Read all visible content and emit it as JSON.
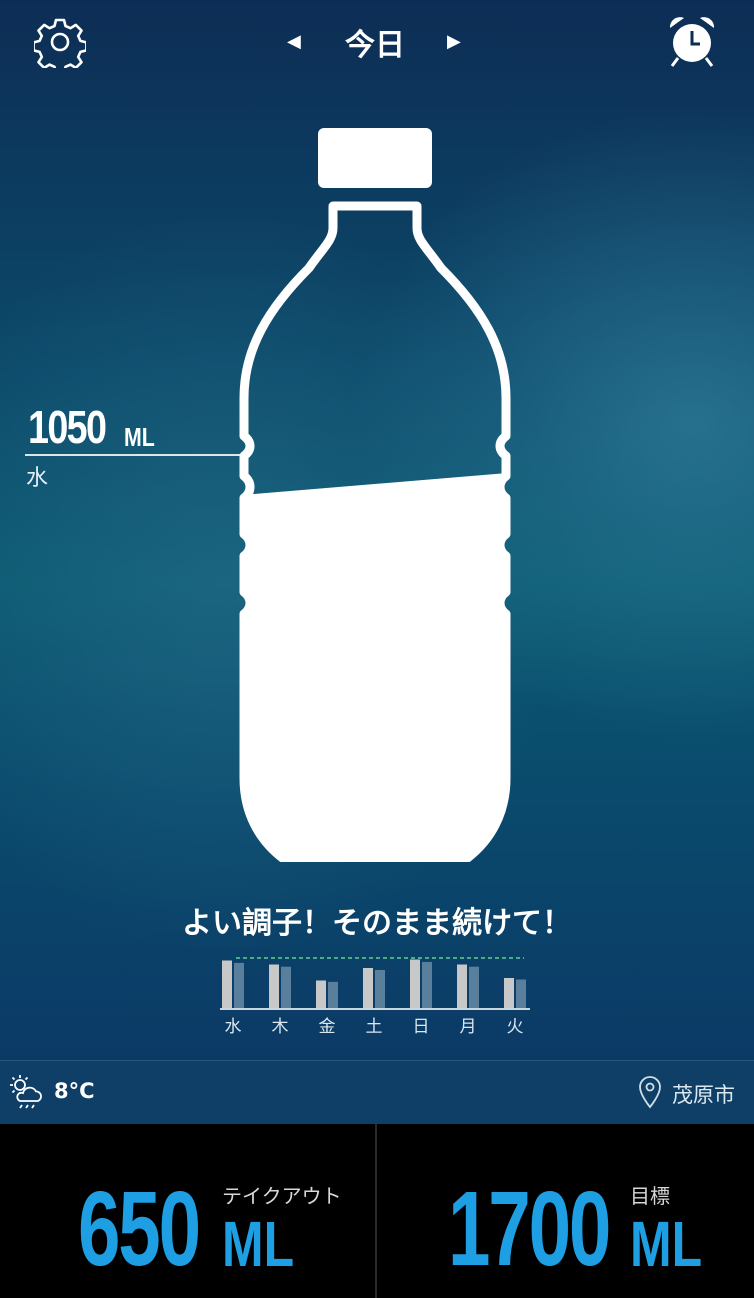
{
  "header": {
    "title": "今日",
    "prev_icon": "◀",
    "next_icon": "▶",
    "settings_icon": "gear-icon",
    "alarm_icon": "alarm-clock-icon"
  },
  "intake": {
    "value": "1050",
    "unit": "ML",
    "drink": "水",
    "fill_fraction": 0.6
  },
  "message": "よい調子！そのまま続けて！",
  "weekly": {
    "days": [
      "水",
      "木",
      "金",
      "土",
      "日",
      "月",
      "火"
    ],
    "values": [
      0.95,
      0.87,
      0.55,
      0.8,
      0.97,
      0.87,
      0.6
    ],
    "targets": [
      0.95,
      0.87,
      0.55,
      0.8,
      0.97,
      0.87,
      0.6
    ]
  },
  "weather": {
    "temperature": "8°C",
    "location": "茂原市",
    "weather_icon": "cloudy-sun-icon",
    "location_icon": "map-pin-icon"
  },
  "stats": {
    "takeout_value": "650",
    "takeout_unit": "ML",
    "takeout_label": "テイクアウト",
    "goal_value": "1700",
    "goal_unit": "ML",
    "goal_label": "目標"
  },
  "colors": {
    "accent": "#1f9fe3",
    "background": "#0b4a6c",
    "bottom_bar": "#000000"
  }
}
